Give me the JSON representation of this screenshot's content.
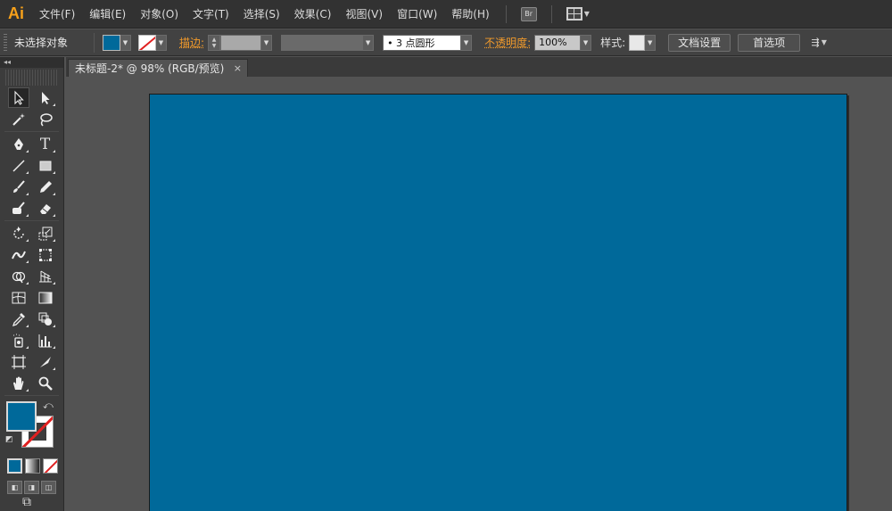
{
  "app": {
    "logo": "Ai"
  },
  "menu": {
    "items": [
      "文件(F)",
      "编辑(E)",
      "对象(O)",
      "文字(T)",
      "选择(S)",
      "效果(C)",
      "视图(V)",
      "窗口(W)",
      "帮助(H)"
    ],
    "bridge_label": "Br"
  },
  "control": {
    "selection_label": "未选择对象",
    "stroke_label": "描边",
    "brush_value": "•  3 点圆形",
    "opacity_label": "不透明度",
    "opacity_value": "100%",
    "style_label": "样式",
    "doc_setup_button": "文档设置",
    "preferences_button": "首选项",
    "colon": ":"
  },
  "tab": {
    "title": "未标题-2* @ 98% (RGB/预览)",
    "close": "×"
  },
  "toolbox": {
    "collapse": "◂◂"
  },
  "colors": {
    "fill": "#00699a",
    "artboard": "#00699a",
    "accent": "#f19a2b",
    "logo": "#f6a01a"
  }
}
